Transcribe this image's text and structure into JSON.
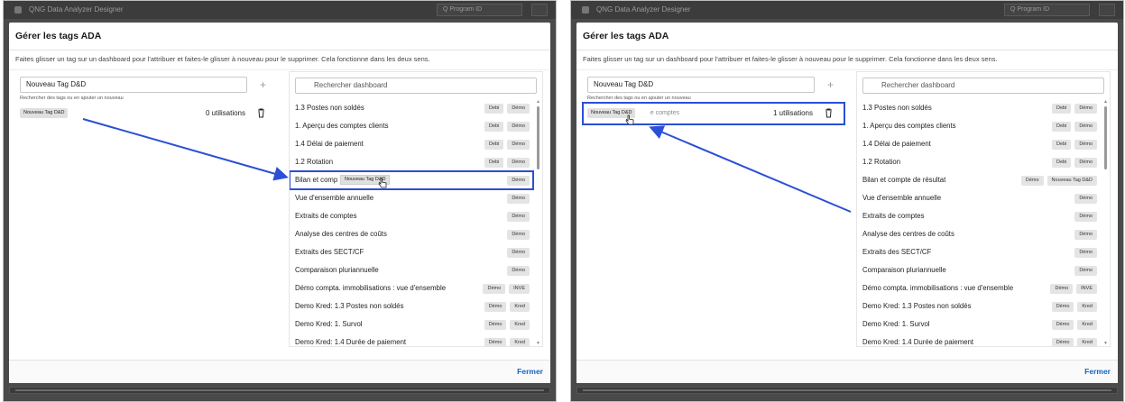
{
  "window": {
    "app_title": "QNG Data Analyzer Designer",
    "search_placeholder": "Q  Program ID"
  },
  "dialog": {
    "title": "Gérer les tags ADA",
    "description": "Faites glisser un tag sur un dashboard pour l'attribuer et faites-le glisser à nouveau pour le supprimer. Cela fonctionne dans les deux sens.",
    "close_label": "Fermer"
  },
  "tags_panel": {
    "input_value": "Nouveau Tag D&D",
    "add_icon": "plus-icon",
    "helper": "Rechercher des tags ou en ajouter un nouveau"
  },
  "left_screen": {
    "tag": {
      "label": "Nouveau Tag D&D",
      "usage": "0 utilisations"
    },
    "drag_chip": "Nouveau Tag D&D",
    "dashboards": [
      {
        "name": "1.3 Postes non soldés",
        "tags": [
          "Debi",
          "Démo"
        ]
      },
      {
        "name": "1. Aperçu des comptes clients",
        "tags": [
          "Debi",
          "Démo"
        ]
      },
      {
        "name": "1.4 Délai de paiement",
        "tags": [
          "Debi",
          "Démo"
        ]
      },
      {
        "name": "1.2 Rotation",
        "tags": [
          "Debi",
          "Démo"
        ]
      },
      {
        "name": "Bilan et comp",
        "tags": [
          "Démo"
        ]
      },
      {
        "name": "Vue d'ensemble annuelle",
        "tags": [
          "Démo"
        ]
      },
      {
        "name": "Extraits de comptes",
        "tags": [
          "Démo"
        ]
      },
      {
        "name": "Analyse des centres de coûts",
        "tags": [
          "Démo"
        ]
      },
      {
        "name": "Extraits des SECT/CF",
        "tags": [
          "Démo"
        ]
      },
      {
        "name": "Comparaison pluriannuelle",
        "tags": [
          "Démo"
        ]
      },
      {
        "name": "Démo compta. immobilisations : vue d'ensemble",
        "tags": [
          "Démo",
          "INVE"
        ]
      },
      {
        "name": "Demo Kred: 1.3 Postes non soldés",
        "tags": [
          "Démo",
          "Kred"
        ]
      },
      {
        "name": "Demo Kred: 1. Survol",
        "tags": [
          "Démo",
          "Kred"
        ]
      },
      {
        "name": "Demo Kred: 1.4 Durée de paiement",
        "tags": [
          "Démo",
          "Kred"
        ]
      }
    ]
  },
  "right_screen": {
    "tag": {
      "label": "Nouveau Tag D&D",
      "ghost_text": "Bilan et compte de résultat",
      "ghost_visible": "e comptes",
      "usage": "1 utilisations"
    },
    "dashboards": [
      {
        "name": "1.3 Postes non soldés",
        "tags": [
          "Debi",
          "Démo"
        ]
      },
      {
        "name": "1. Aperçu des comptes clients",
        "tags": [
          "Debi",
          "Démo"
        ]
      },
      {
        "name": "1.4 Délai de paiement",
        "tags": [
          "Debi",
          "Démo"
        ]
      },
      {
        "name": "1.2 Rotation",
        "tags": [
          "Debi",
          "Démo"
        ]
      },
      {
        "name": "Bilan et compte de résultat",
        "tags": [
          "Démo",
          "Nouveau Tag D&D"
        ]
      },
      {
        "name": "Vue d'ensemble annuelle",
        "tags": [
          "Démo"
        ]
      },
      {
        "name": "Extraits de comptes",
        "tags": [
          "Démo"
        ]
      },
      {
        "name": "Analyse des centres de coûts",
        "tags": [
          "Démo"
        ]
      },
      {
        "name": "Extraits des SECT/CF",
        "tags": [
          "Démo"
        ]
      },
      {
        "name": "Comparaison pluriannuelle",
        "tags": [
          "Démo"
        ]
      },
      {
        "name": "Démo compta. immobilisations : vue d'ensemble",
        "tags": [
          "Démo",
          "INVE"
        ]
      },
      {
        "name": "Demo Kred: 1.3 Postes non soldés",
        "tags": [
          "Démo",
          "Kred"
        ]
      },
      {
        "name": "Demo Kred: 1. Survol",
        "tags": [
          "Démo",
          "Kred"
        ]
      },
      {
        "name": "Demo Kred: 1.4 Durée de paiement",
        "tags": [
          "Démo",
          "Kred"
        ]
      }
    ]
  },
  "dashboards_panel": {
    "search_placeholder": "Rechercher dashboard",
    "search_icon": "search-icon"
  },
  "colors": {
    "highlight": "#2b4fd6",
    "close_link": "#1565c0",
    "chip_bg": "#e4e4e4"
  }
}
